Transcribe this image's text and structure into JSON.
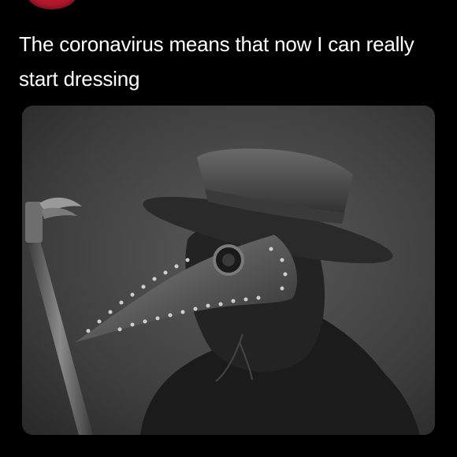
{
  "tweet": {
    "text": "The coronavirus means that now I can really start dressing"
  },
  "media": {
    "icon": "plague-doctor-photo",
    "colors": {
      "background": "#000000",
      "text": "#ffffff",
      "avatar": "#b5182d"
    }
  }
}
